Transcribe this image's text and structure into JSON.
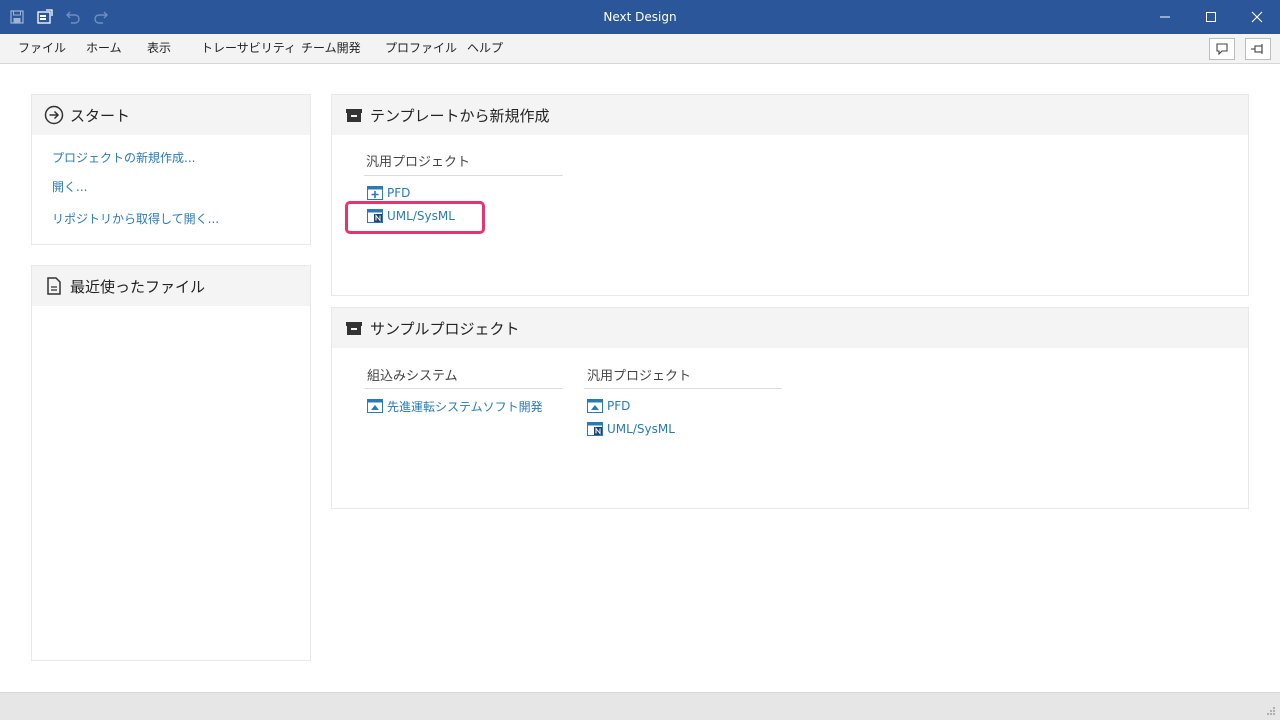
{
  "window": {
    "title": "Next Design"
  },
  "menu": {
    "items": [
      "ファイル",
      "ホーム",
      "表示",
      "トレーサビリティ",
      "チーム開発",
      "プロファイル",
      "ヘルプ"
    ]
  },
  "start": {
    "title": "スタート",
    "links": [
      "プロジェクトの新規作成...",
      "開く...",
      "リポジトリから取得して開く..."
    ]
  },
  "recent": {
    "title": "最近使ったファイル"
  },
  "templates": {
    "title": "テンプレートから新規作成",
    "group_title": "汎用プロジェクト",
    "items": [
      "PFD",
      "UML/SysML"
    ]
  },
  "samples": {
    "title": "サンプルプロジェクト",
    "groups": [
      {
        "title": "組込みシステム",
        "items": [
          "先進運転システムソフト開発"
        ]
      },
      {
        "title": "汎用プロジェクト",
        "items": [
          "PFD",
          "UML/SysML"
        ]
      }
    ]
  },
  "colors": {
    "titlebar": "#2b579a",
    "link": "#2a7ab8",
    "highlight": "#e8336d"
  }
}
